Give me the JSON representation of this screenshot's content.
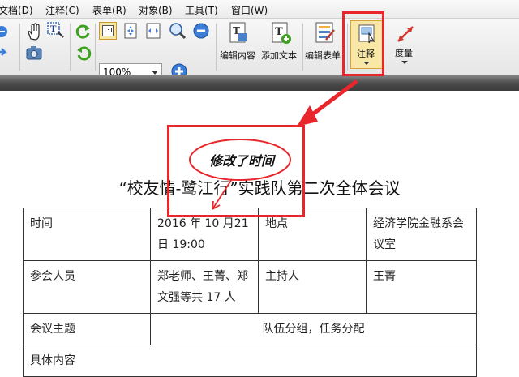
{
  "menu": [
    {
      "label": "文档(D)"
    },
    {
      "label": "注释(C)"
    },
    {
      "label": "表单(R)"
    },
    {
      "label": "对象(B)"
    },
    {
      "label": "工具(T)"
    },
    {
      "label": "窗口(W)"
    }
  ],
  "toolbar": {
    "zoom_value": "100%",
    "edit_content": "编辑内容",
    "add_text": "添加文本",
    "edit_form": "编辑表单",
    "annotate": "注释",
    "measure": "度量",
    "actual_size": "1:1"
  },
  "annotation": {
    "note_text": "修改了时间",
    "accent_color": "#e8262b"
  },
  "document": {
    "title": "“校友情-鹭江行”实践队第二次全体会议",
    "rows": [
      {
        "c1": "时间",
        "c2": "2016 年 10 月21日 19:00",
        "c3": "地点",
        "c4": "经济学院金融系会议室"
      },
      {
        "c1": "参会人员",
        "c2": "郑老师、王菁、郑文强等共 17 人",
        "c3": "主持人",
        "c4": "王菁"
      }
    ],
    "topic_label": "会议主题",
    "topic_value": "队伍分组，任务分配",
    "content_label": "具体内容"
  }
}
